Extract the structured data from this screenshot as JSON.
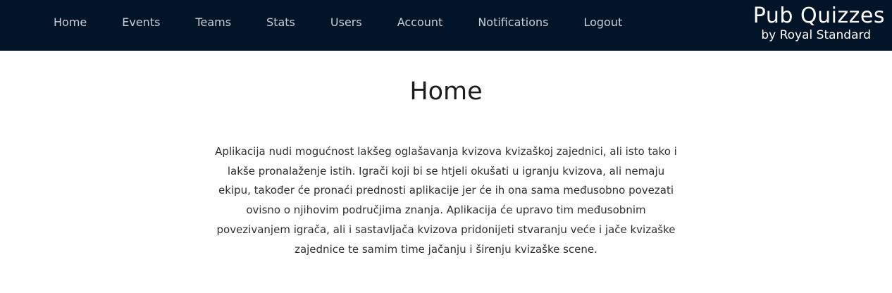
{
  "nav": {
    "items": [
      {
        "label": "Home"
      },
      {
        "label": "Events"
      },
      {
        "label": "Teams"
      },
      {
        "label": "Stats"
      },
      {
        "label": "Users"
      },
      {
        "label": "Account"
      },
      {
        "label": "Notifications"
      },
      {
        "label": "Logout"
      }
    ]
  },
  "brand": {
    "title": "Pub Quizzes",
    "subtitle": "by Royal Standard"
  },
  "main": {
    "title": "Home",
    "intro": "Aplikacija nudi mogućnost lakšeg oglašavanja kvizova kvizaškoj zajednici, ali isto tako i lakše pronalaženje istih. Igrači koji bi se htjeli okušati u igranju kvizova, ali nemaju ekipu, također će pronaći prednosti aplikacije jer će ih ona sama međusobno povezati ovisno o njihovim područjima znanja. Aplikacija će upravo tim međusobnim povezivanjem igrača, ali i sastavljača kvizova pridonijeti stvaranju veće i jače kvizaške zajednice te samim time jačanju i širenju kvizaške scene."
  },
  "colors": {
    "navbar_bg": "#021428",
    "nav_text": "#c9ced6",
    "brand_text": "#ffffff",
    "body_text": "#2e2e2e"
  }
}
